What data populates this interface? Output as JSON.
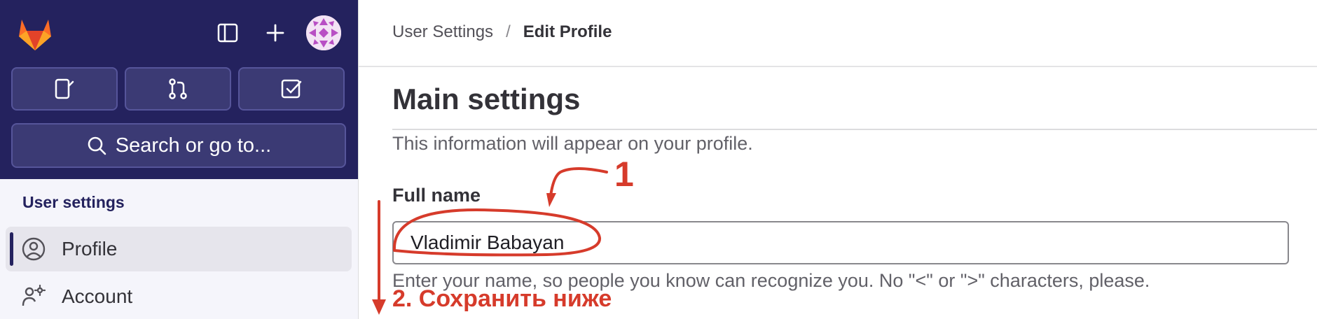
{
  "sidebar": {
    "top_icons": [
      "tanuki-logo-icon",
      "sidebar-toggle-icon",
      "plus-icon",
      "user-avatar"
    ],
    "shortcuts": [
      "issues-icon",
      "merge-request-icon",
      "todo-icon"
    ],
    "search": {
      "label": "Search or go to..."
    },
    "section_title": "User settings",
    "items": [
      {
        "label": "Profile",
        "icon": "user-circle-icon",
        "active": true
      },
      {
        "label": "Account",
        "icon": "account-settings-icon",
        "active": false
      }
    ]
  },
  "breadcrumb": {
    "parent": "User Settings",
    "separator": "/",
    "current": "Edit Profile"
  },
  "main": {
    "title": "Main settings",
    "description": "This information will appear on your profile.",
    "full_name": {
      "label": "Full name",
      "value": "Vladimir Babayan",
      "help": "Enter your name, so people you know can recognize you. No \"<\" or \">\" characters, please."
    }
  },
  "annotations": {
    "step1": "1",
    "step2": "2. Сохранить ниже",
    "color": "#d63b2b"
  },
  "colors": {
    "sidebar_dark": "#24225e",
    "accent_red": "#d63b2b",
    "logo_orange": "#e24329"
  }
}
